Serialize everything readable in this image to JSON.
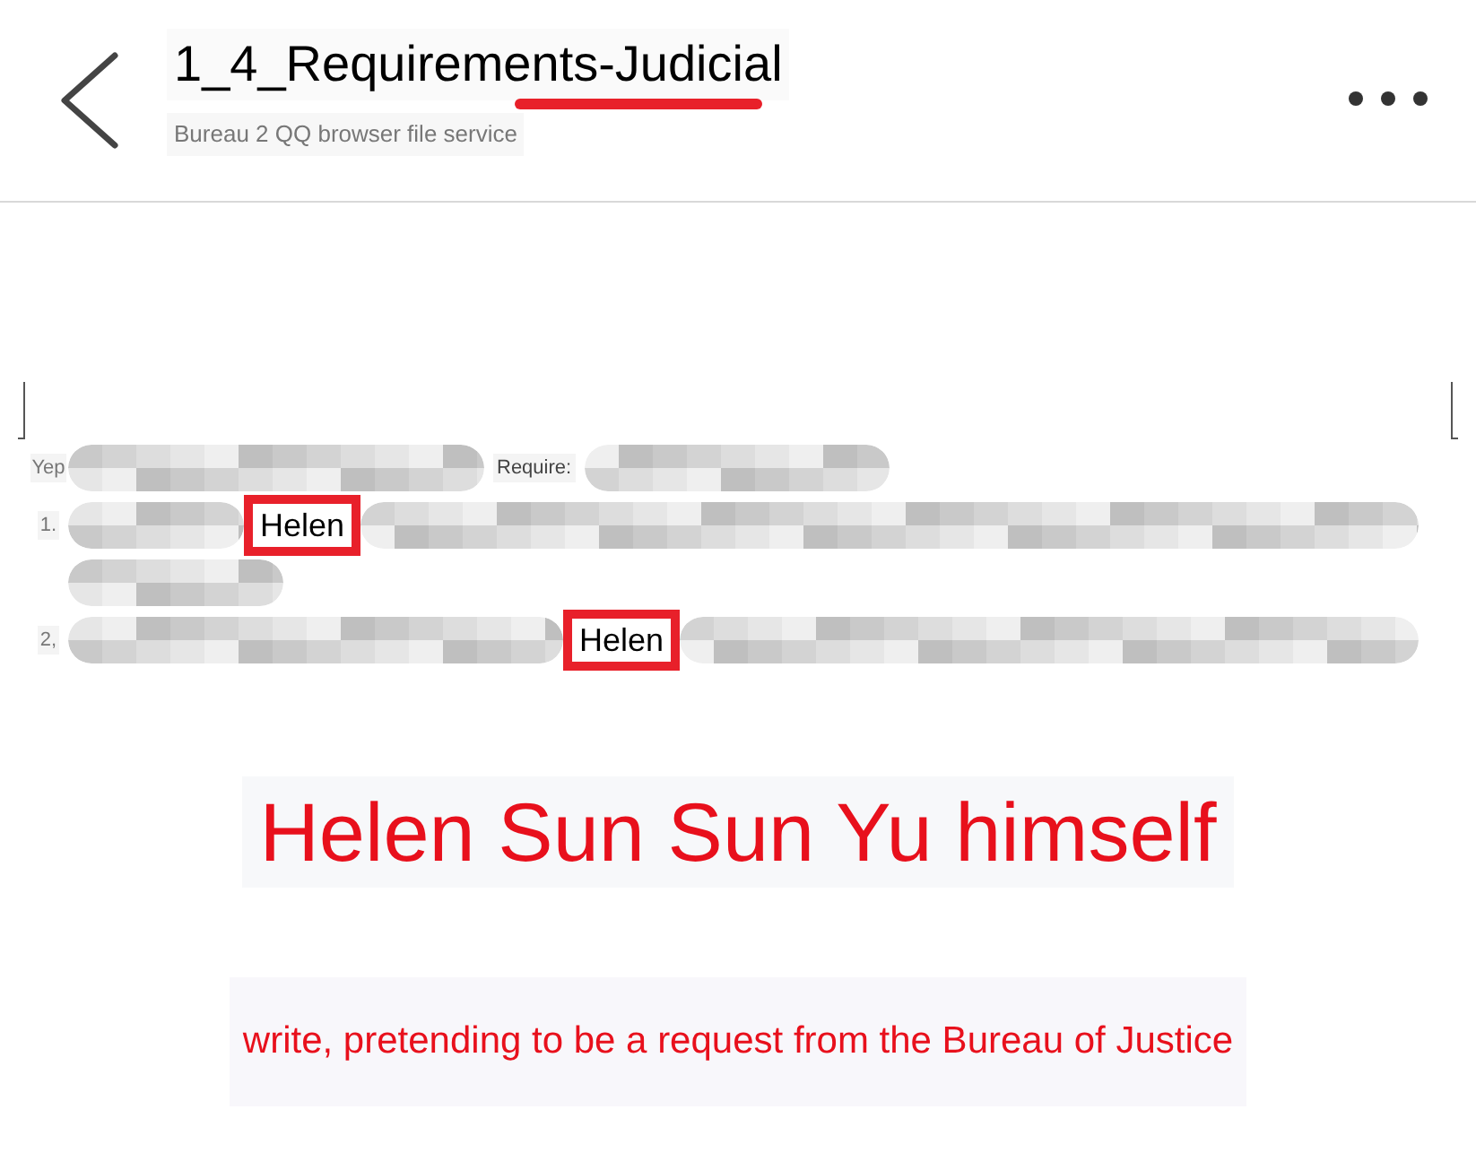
{
  "header": {
    "title": "1_4_Requirements-Judicial",
    "subtitle": "Bureau 2 QQ browser file service"
  },
  "document": {
    "lines": [
      {
        "marker": "Yep",
        "segments": [
          {
            "kind": "blur"
          },
          {
            "kind": "text",
            "text": "Require:"
          },
          {
            "kind": "blur"
          }
        ]
      },
      {
        "marker": "1.",
        "segments": [
          {
            "kind": "blur"
          },
          {
            "kind": "boxed",
            "text": "Helen"
          },
          {
            "kind": "blur"
          }
        ]
      },
      {
        "segments": [
          {
            "kind": "blur"
          }
        ]
      },
      {
        "marker": "2,",
        "segments": [
          {
            "kind": "blur"
          },
          {
            "kind": "boxed",
            "text": "Helen"
          },
          {
            "kind": "blur"
          }
        ]
      }
    ]
  },
  "headline": "Helen Sun Sun Yu himself",
  "caption": "write, pretending to be a request from the Bureau of Justice"
}
